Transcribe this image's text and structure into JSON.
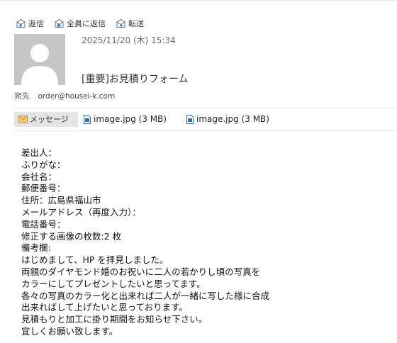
{
  "toolbar": {
    "reply_label": "返信",
    "reply_all_label": "全員に返信",
    "forward_label": "転送"
  },
  "header": {
    "date": "2025/11/20 (木) 15:34",
    "subject": "[重要]お見積りフォーム",
    "to_label": "宛先",
    "to_value": "order@housei-k.com"
  },
  "attachments": {
    "message_tab_label": "メッセージ",
    "files": [
      {
        "name": "image.jpg (3 MB)"
      },
      {
        "name": "image.jpg (3 MB)"
      }
    ]
  },
  "body_lines": [
    "差出人：",
    "ふりがな：",
    "会社名：",
    "郵便番号：",
    "住所：広島県福山市",
    "メールアドレス（再度入力）：",
    "電話番号：",
    "修正する画像の枚数:2 枚",
    "備考欄:",
    "はじめまして、HP を拝見しました。",
    "両親のダイヤモンド婚のお祝いに二人の若かりし頃の写真を",
    "カラーにしてプレゼントしたいと思ってます。",
    "各々の写真のカラー化と出来れば二人が一緒に写した様に合成",
    "出来ればして上げたいと思っております。",
    "見積もりと加工に掛り期間をお知らせ下さい。",
    "宜しくお願い致します。"
  ]
}
